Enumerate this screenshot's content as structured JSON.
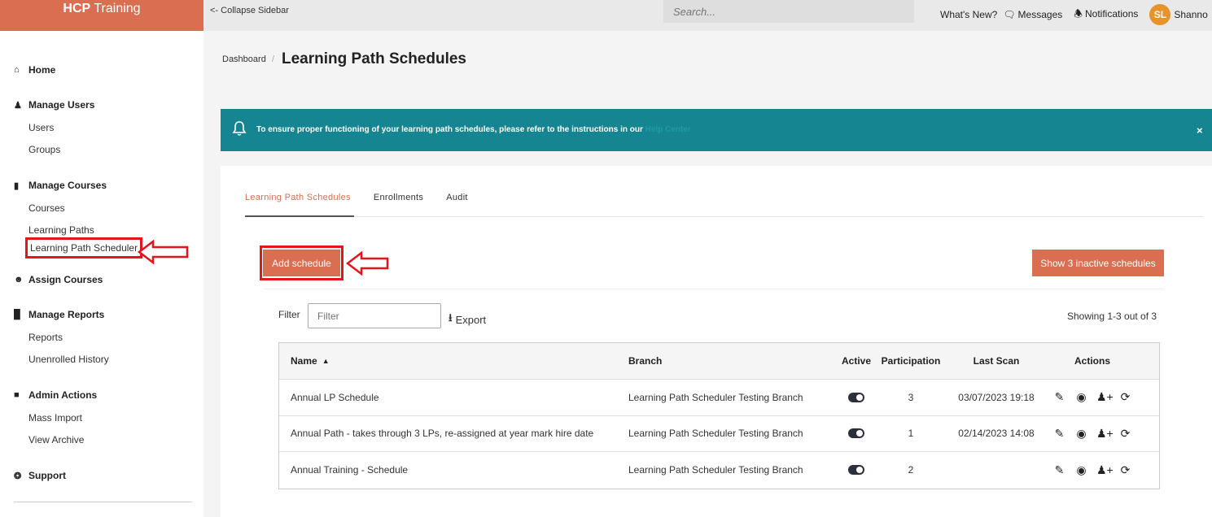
{
  "sidebar": {
    "brand_bold": "HCP",
    "brand_rest": " Training",
    "sections": [
      {
        "label": "Home",
        "icon": "home-icon"
      },
      {
        "label": "Manage Users",
        "icon": "user-icon",
        "items": [
          "Users",
          "Groups"
        ]
      },
      {
        "label": "Manage Courses",
        "icon": "book-icon",
        "items": [
          "Courses",
          "Learning Paths",
          "Learning Path Scheduler"
        ]
      },
      {
        "label": "Assign Courses",
        "icon": "user-circle-icon"
      },
      {
        "label": "Manage Reports",
        "icon": "bar-chart-icon",
        "items": [
          "Reports",
          "Unenrolled History"
        ]
      },
      {
        "label": "Admin Actions",
        "icon": "lock-icon",
        "items": [
          "Mass Import",
          "View Archive"
        ]
      },
      {
        "label": "Support",
        "icon": "life-ring-icon"
      }
    ]
  },
  "topbar": {
    "collapse_label": "<- Collapse Sidebar",
    "search_placeholder": "Search...",
    "whats_new": "What's New?",
    "messages": "Messages",
    "notifications": "Notifications",
    "avatar_initials": "SL",
    "user_name": "Shanno"
  },
  "breadcrumb": {
    "parent": "Dashboard",
    "separator": "/",
    "title": "Learning Path Schedules"
  },
  "banner": {
    "message": "To ensure proper functioning of your learning path schedules, please refer to the instructions in our ",
    "link": "Help Center",
    "close": "×"
  },
  "tabs": [
    "Learning Path Schedules",
    "Enrollments",
    "Audit"
  ],
  "buttons": {
    "add_schedule": "Add schedule",
    "show_inactive": "Show 3 inactive schedules"
  },
  "filter": {
    "label": "Filter",
    "placeholder": "Filter",
    "export": "Export",
    "showing": "Showing 1-3 out of 3"
  },
  "table": {
    "columns": [
      "Name",
      "Branch",
      "Active",
      "Participation",
      "Last Scan",
      "Actions"
    ],
    "rows": [
      {
        "name": "Annual LP Schedule",
        "branch": "Learning Path Scheduler Testing Branch",
        "active": true,
        "participation": "3",
        "last_scan": "03/07/2023 19:18"
      },
      {
        "name": "Annual Path - takes through 3 LPs, re-assigned at year mark hire date",
        "branch": "Learning Path Scheduler Testing Branch",
        "active": true,
        "participation": "1",
        "last_scan": "02/14/2023 14:08"
      },
      {
        "name": "Annual Training - Schedule",
        "branch": "Learning Path Scheduler Testing Branch",
        "active": true,
        "participation": "2",
        "last_scan": ""
      }
    ]
  },
  "colors": {
    "brand": "#d96e50",
    "banner": "#158591",
    "annotation": "#e3151a"
  }
}
